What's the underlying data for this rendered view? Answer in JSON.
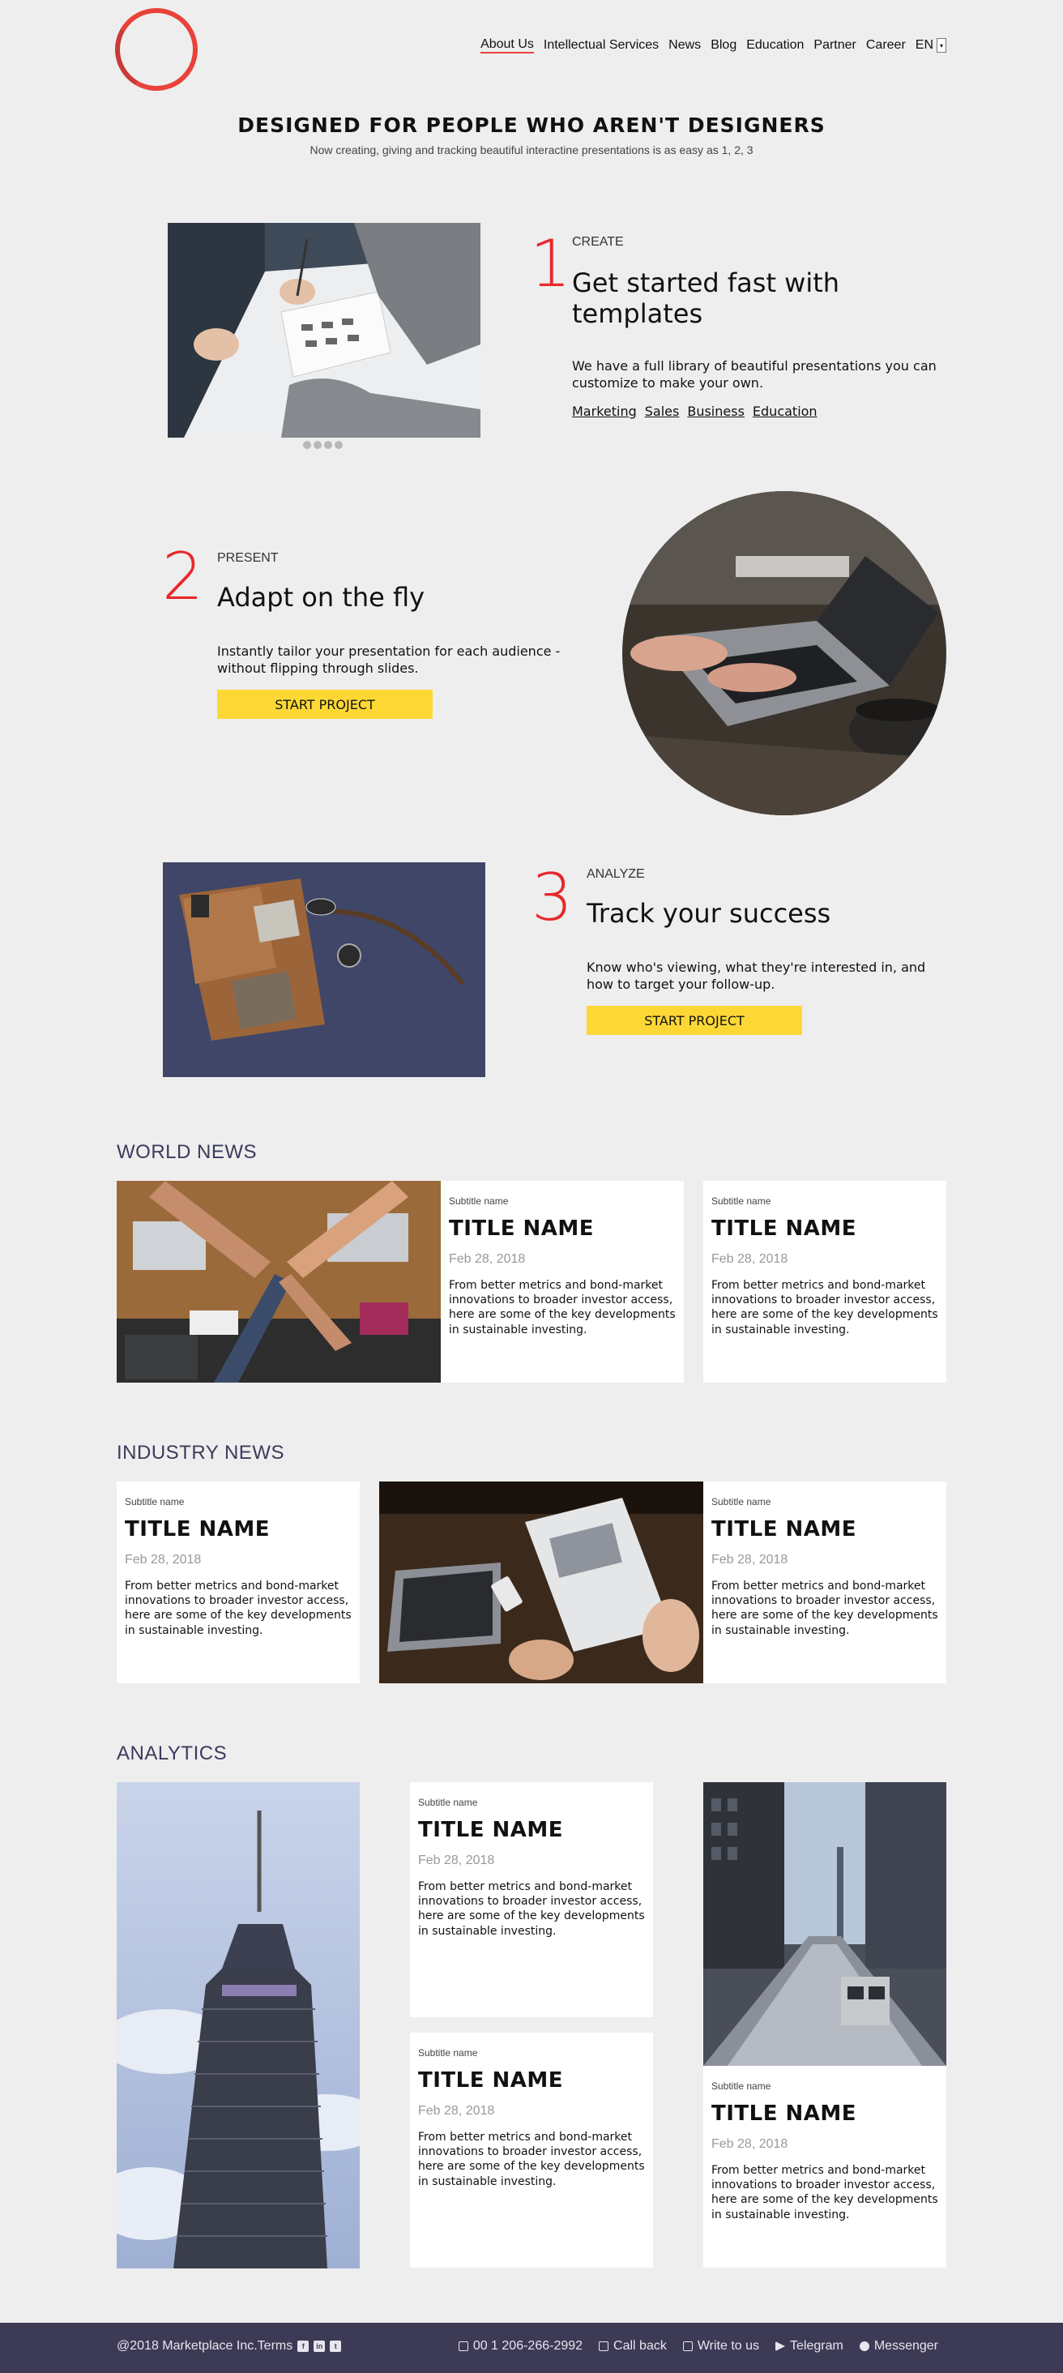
{
  "nav": {
    "items": [
      "About Us",
      "Intellectual Services",
      "News",
      "Blog",
      "Education",
      "Partner",
      "Career"
    ],
    "lang": "EN"
  },
  "hero": {
    "title": "DESIGNED FOR PEOPLE WHO AREN'T DESIGNERS",
    "subtitle": "Now creating, giving and tracking beautiful interactine presentations is as easy as 1, 2, 3"
  },
  "features": [
    {
      "num": "1",
      "kicker": "CREATE",
      "title": "Get started fast with templates",
      "desc": "We have a full library of beautiful presentations you can customize to make your own.",
      "links": [
        "Marketing",
        "Sales",
        "Business",
        "Education"
      ]
    },
    {
      "num": "2",
      "kicker": "PRESENT",
      "title": "Adapt on the fly",
      "desc": "Instantly tailor your presentation for each audience - without flipping through slides.",
      "button": "START PROJECT"
    },
    {
      "num": "3",
      "kicker": "ANALYZE",
      "title": "Track your success",
      "desc": "Know who's viewing, what they're interested in, and how to target your follow-up.",
      "button": "START PROJECT"
    }
  ],
  "sections": {
    "world": "WORLD NEWS",
    "industry": "INDUSTRY NEWS",
    "analytics": "ANALYTICS"
  },
  "card": {
    "subtitle": "Subtitle name",
    "title": "TITLE NAME",
    "date": "Feb 28, 2018",
    "text": "From better metrics and bond-market innovations to broader investor access, here are some of the key developments in sustainable investing."
  },
  "footer": {
    "copyright": "@2018 Marketplace Inc.Terms",
    "phone": "00 1 206-266-2992",
    "callback": "Call back",
    "write": "Write to us",
    "telegram": "Telegram",
    "messenger": "Messenger"
  },
  "colors": {
    "accent": "#e8282a",
    "button": "#fdd835",
    "footer": "#3d3a56",
    "background": "#eeeeee"
  }
}
